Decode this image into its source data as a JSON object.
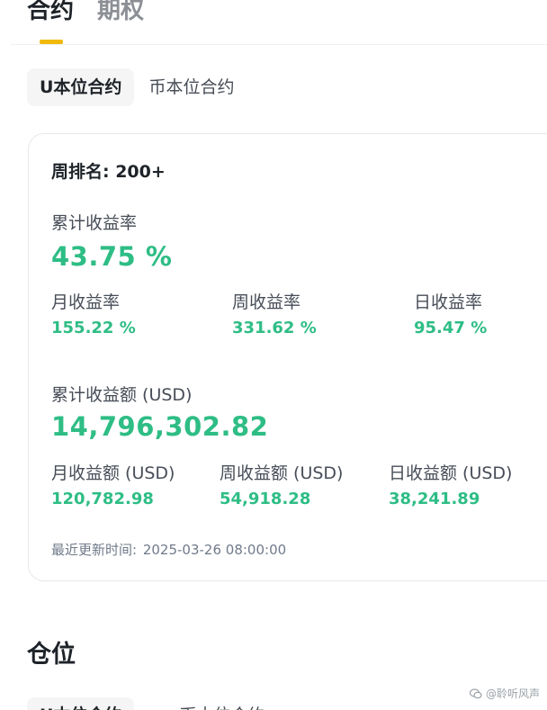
{
  "top_tabs": [
    {
      "label": "合约",
      "active": true
    },
    {
      "label": "期权",
      "active": false
    }
  ],
  "sub_tabs": [
    {
      "label": "U本位合约",
      "active": true
    },
    {
      "label": "币本位合约",
      "active": false
    }
  ],
  "stats": {
    "rank_label": "周排名: 200+",
    "total_rate_label": "累计收益率",
    "total_rate_value": "43.75 %",
    "rates": [
      {
        "label": "月收益率",
        "value": "155.22 %"
      },
      {
        "label": "周收益率",
        "value": "331.62 %"
      },
      {
        "label": "日收益率",
        "value": "95.47 %"
      }
    ],
    "total_amount_label": "累计收益额 (USD)",
    "total_amount_value": "14,796,302.82",
    "amounts": [
      {
        "label": "月收益额 (USD)",
        "value": "120,782.98"
      },
      {
        "label": "周收益额 (USD)",
        "value": "54,918.28"
      },
      {
        "label": "日收益额 (USD)",
        "value": "38,241.89"
      }
    ],
    "updated_label": "最近更新时间:",
    "updated_value": "2025-03-26 08:00:00"
  },
  "positions": {
    "title": "仓位",
    "tabs": [
      {
        "label": "U本位合约",
        "active": true
      },
      {
        "label": "币本位合约",
        "active": false
      }
    ]
  },
  "watermark": {
    "text": "@聆听风声",
    "icon": "wechat-bubble-icon"
  },
  "colors": {
    "accent": "#f0b90b",
    "positive": "#2ebd85",
    "text": "#1e2329",
    "muted": "#474d57"
  }
}
